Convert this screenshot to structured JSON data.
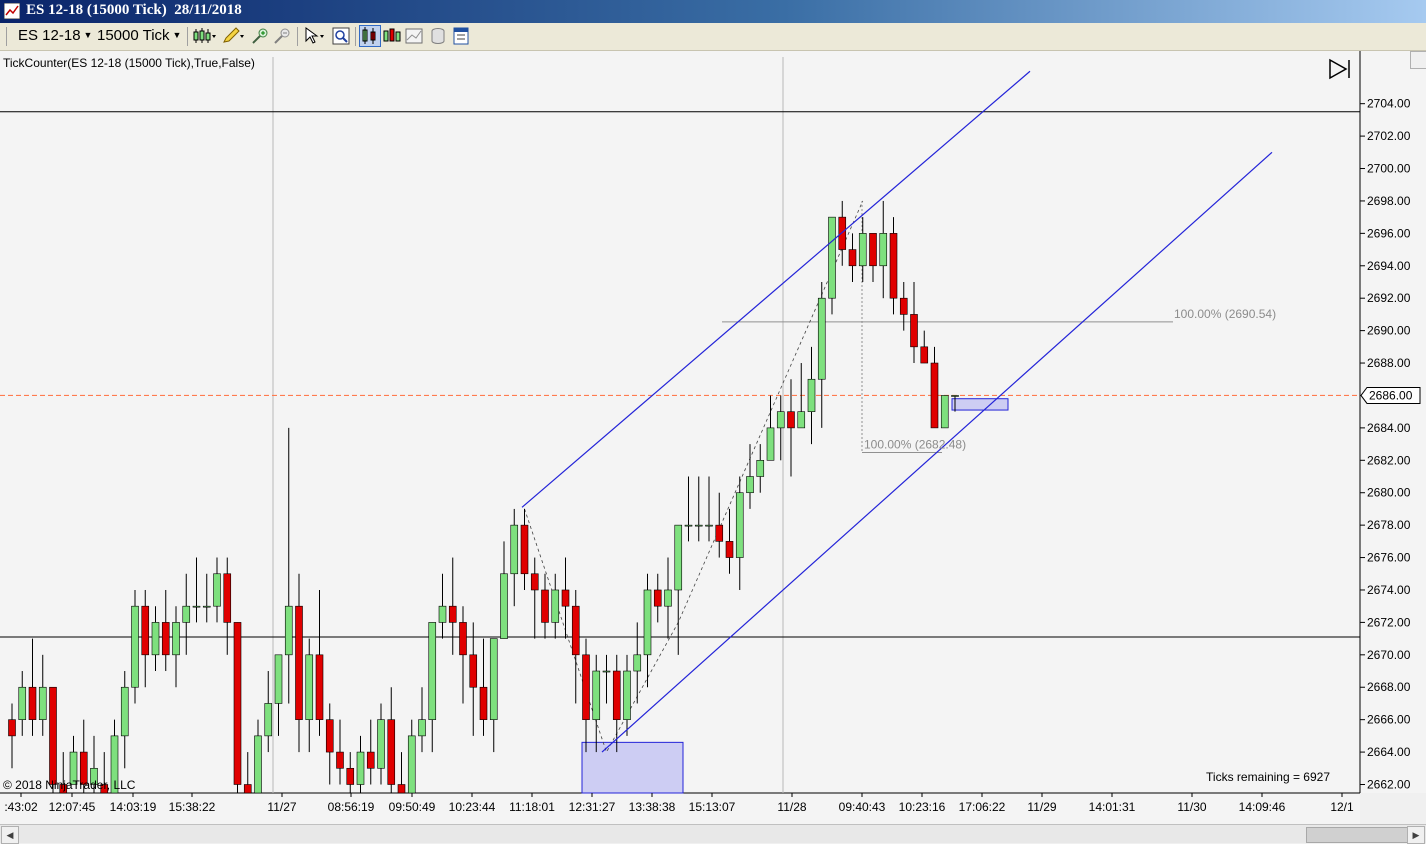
{
  "window": {
    "title": "ES 12-18 (15000 Tick)  28/11/2018",
    "instrument": "ES 12-18",
    "period": "15000 Tick"
  },
  "toolbar_icons": [
    "bar-type-icon",
    "drawing-pencil-icon",
    "zoom-in-icon",
    "zoom-out-icon",
    "pointer-cursor-icon",
    "data-box-icon",
    "chart-style-icon",
    "indicators-icon",
    "strategies-icon",
    "properties-icon"
  ],
  "indicator_label": "TickCounter(ES  12-18 (15000  Tick),True,False)",
  "copyright": "© 2018 NinjaTrader, LLC",
  "ticks_remaining": "Ticks remaining = 6927",
  "current_price_label": "2686.00",
  "colors": {
    "up_candle": "#7ee07e",
    "down_candle": "#e00000",
    "channel_line": "#2424d8",
    "horizontal_line": "#000000",
    "price_line": "#ff7b4f",
    "zone_fill": "#c5c6f2",
    "fib_text": "#8c8c8c"
  },
  "chart_data": {
    "type": "candlestick",
    "y_range": [
      2661,
      2706
    ],
    "y_ticks": [
      "2704.00",
      "2702.00",
      "2700.00",
      "2698.00",
      "2696.00",
      "2694.00",
      "2692.00",
      "2690.00",
      "2688.00",
      "2686.00",
      "2684.00",
      "2682.00",
      "2680.00",
      "2678.00",
      "2676.00",
      "2674.00",
      "2672.00",
      "2670.00",
      "2668.00",
      "2666.00",
      "2664.00",
      "2662.00"
    ],
    "x_tick_labels": [
      ":43:02",
      "12:07:45",
      "14:03:19",
      "15:38:22",
      "11/27",
      "08:56:19",
      "09:50:49",
      "10:23:44",
      "11:18:01",
      "12:31:27",
      "13:38:38",
      "15:13:07",
      "11/28",
      "09:40:43",
      "10:23:16",
      "17:06:22",
      "11/29",
      "14:01:31",
      "11/30",
      "14:09:46",
      "12/1"
    ],
    "session_dividers": [
      "11/27",
      "11/28"
    ],
    "ohlc": [
      [
        2666,
        2667,
        2663,
        2665
      ],
      [
        2666,
        2669,
        2665,
        2668
      ],
      [
        2668,
        2671,
        2665,
        2666
      ],
      [
        2666,
        2670,
        2665,
        2668
      ],
      [
        2668,
        2668,
        2660,
        2662
      ],
      [
        2662,
        2664,
        2660,
        2661
      ],
      [
        2662,
        2665,
        2662,
        2664
      ],
      [
        2664,
        2666,
        2661,
        2662
      ],
      [
        2662,
        2665,
        2661,
        2663
      ],
      [
        2662,
        2664,
        2660,
        2661
      ],
      [
        2661,
        2666,
        2660,
        2665
      ],
      [
        2665,
        2669,
        2663,
        2668
      ],
      [
        2668,
        2674,
        2667,
        2673
      ],
      [
        2673,
        2674,
        2668,
        2670
      ],
      [
        2670,
        2673,
        2669,
        2672
      ],
      [
        2672,
        2674,
        2669,
        2670
      ],
      [
        2670,
        2673,
        2668,
        2672
      ],
      [
        2672,
        2675,
        2670,
        2673
      ],
      [
        2673,
        2676,
        2672,
        2673
      ],
      [
        2673,
        2675,
        2672,
        2673
      ],
      [
        2673,
        2676,
        2672,
        2675
      ],
      [
        2675,
        2676,
        2670,
        2672
      ],
      [
        2672,
        2672,
        2661,
        2662
      ],
      [
        2662,
        2664,
        2660,
        2661
      ],
      [
        2661,
        2666,
        2660,
        2665
      ],
      [
        2665,
        2669,
        2664,
        2667
      ],
      [
        2667,
        2670,
        2665,
        2670
      ],
      [
        2670,
        2684,
        2667,
        2673
      ],
      [
        2673,
        2675,
        2664,
        2666
      ],
      [
        2666,
        2671,
        2664,
        2670
      ],
      [
        2670,
        2674,
        2665,
        2666
      ],
      [
        2666,
        2667,
        2662,
        2664
      ],
      [
        2664,
        2666,
        2662,
        2663
      ],
      [
        2663,
        2664,
        2661,
        2662
      ],
      [
        2662,
        2665,
        2660,
        2664
      ],
      [
        2664,
        2666,
        2662,
        2663
      ],
      [
        2663,
        2667,
        2662,
        2666
      ],
      [
        2666,
        2668,
        2661,
        2662
      ],
      [
        2662,
        2664,
        2660,
        2661
      ],
      [
        2661,
        2666,
        2660,
        2665
      ],
      [
        2665,
        2668,
        2664,
        2666
      ],
      [
        2666,
        2672,
        2664,
        2672
      ],
      [
        2672,
        2675,
        2671,
        2673
      ],
      [
        2673,
        2676,
        2670,
        2672
      ],
      [
        2672,
        2673,
        2667,
        2670
      ],
      [
        2670,
        2672,
        2665,
        2668
      ],
      [
        2668,
        2671,
        2665,
        2666
      ],
      [
        2666,
        2671,
        2664,
        2671
      ],
      [
        2671,
        2677,
        2671,
        2675
      ],
      [
        2675,
        2679,
        2673,
        2678
      ],
      [
        2678,
        2679,
        2674,
        2675
      ],
      [
        2675,
        2676,
        2671,
        2674
      ],
      [
        2674,
        2675,
        2671,
        2672
      ],
      [
        2672,
        2675,
        2671,
        2674
      ],
      [
        2674,
        2676,
        2671,
        2673
      ],
      [
        2673,
        2674,
        2667,
        2670
      ],
      [
        2670,
        2671,
        2664,
        2666
      ],
      [
        2666,
        2670,
        2664,
        2669
      ],
      [
        2669,
        2670,
        2667,
        2669
      ],
      [
        2669,
        2670,
        2664,
        2666
      ],
      [
        2666,
        2670,
        2665,
        2669
      ],
      [
        2669,
        2672,
        2667,
        2670
      ],
      [
        2670,
        2675,
        2668,
        2674
      ],
      [
        2674,
        2675,
        2672,
        2673
      ],
      [
        2673,
        2676,
        2671,
        2674
      ],
      [
        2674,
        2678,
        2670,
        2678
      ],
      [
        2678,
        2681,
        2677,
        2678
      ],
      [
        2678,
        2681,
        2677,
        2678
      ],
      [
        2678,
        2681,
        2677,
        2678
      ],
      [
        2678,
        2680,
        2676,
        2677
      ],
      [
        2677,
        2679,
        2675,
        2676
      ],
      [
        2676,
        2681,
        2674,
        2680
      ],
      [
        2680,
        2683,
        2679,
        2681
      ],
      [
        2681,
        2683,
        2680,
        2682
      ],
      [
        2682,
        2686,
        2682,
        2684
      ],
      [
        2684,
        2686,
        2682,
        2685
      ],
      [
        2685,
        2687,
        2681,
        2684
      ],
      [
        2684,
        2688,
        2684,
        2685
      ],
      [
        2685,
        2689,
        2683,
        2687
      ],
      [
        2687,
        2693,
        2684,
        2692
      ],
      [
        2692,
        2697,
        2691,
        2697
      ],
      [
        2697,
        2698,
        2694,
        2695
      ],
      [
        2695,
        2696,
        2693,
        2694
      ],
      [
        2694,
        2697,
        2693,
        2696
      ],
      [
        2696,
        2696,
        2693,
        2694
      ],
      [
        2694,
        2698,
        2692,
        2696
      ],
      [
        2696,
        2697,
        2691,
        2692
      ],
      [
        2692,
        2693,
        2690,
        2691
      ],
      [
        2691,
        2693,
        2688,
        2689
      ],
      [
        2689,
        2690,
        2688,
        2688
      ],
      [
        2688,
        2689,
        2684,
        2684
      ],
      [
        2684,
        2686,
        2684,
        2686
      ],
      [
        2686,
        2686,
        2685,
        2686
      ]
    ],
    "horizontal_lines": [
      2703.5,
      2671.1
    ],
    "current_price": 2686.0,
    "fibonacci_labels": [
      {
        "text": "100.00% (2690.54)",
        "price": 2690.54
      },
      {
        "text": "100.00% (2682.48)",
        "price": 2682.48
      }
    ],
    "channel": {
      "upper": [
        [
          2679.1,
          2706.0
        ]
      ],
      "lower": [
        [
          2664.0,
          2701.0
        ]
      ]
    },
    "zones": [
      {
        "price_high": 2664.6,
        "price_low": 2661.0
      },
      {
        "price_high": 2685.8,
        "price_low": 2685.1
      }
    ]
  }
}
